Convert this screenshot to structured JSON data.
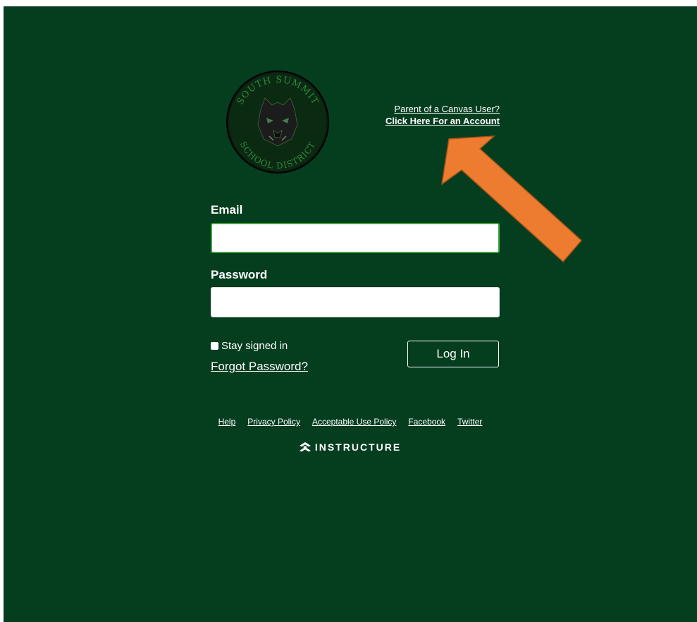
{
  "colors": {
    "background": "#053D1F",
    "accent_arrow": "#EE7C30",
    "focus_border": "#3AA53A",
    "text": "#FFFFFF"
  },
  "logo": {
    "top_text": "SOUTH SUMMIT",
    "bottom_text": "SCHOOL DISTRICT",
    "icon": "wildcat-icon"
  },
  "parent": {
    "question": "Parent of a Canvas User?",
    "link": "Click Here For an Account"
  },
  "form": {
    "email_label": "Email",
    "email_value": "",
    "password_label": "Password",
    "password_value": "",
    "stay_signed_in": "Stay signed in",
    "forgot": "Forgot Password?",
    "login": "Log In"
  },
  "footer": {
    "links": [
      "Help",
      "Privacy Policy",
      "Acceptable Use Policy",
      "Facebook",
      "Twitter"
    ]
  },
  "brand": {
    "name": "INSTRUCTURE",
    "icon": "instructure-icon"
  },
  "annotation": {
    "icon": "arrow-icon"
  }
}
